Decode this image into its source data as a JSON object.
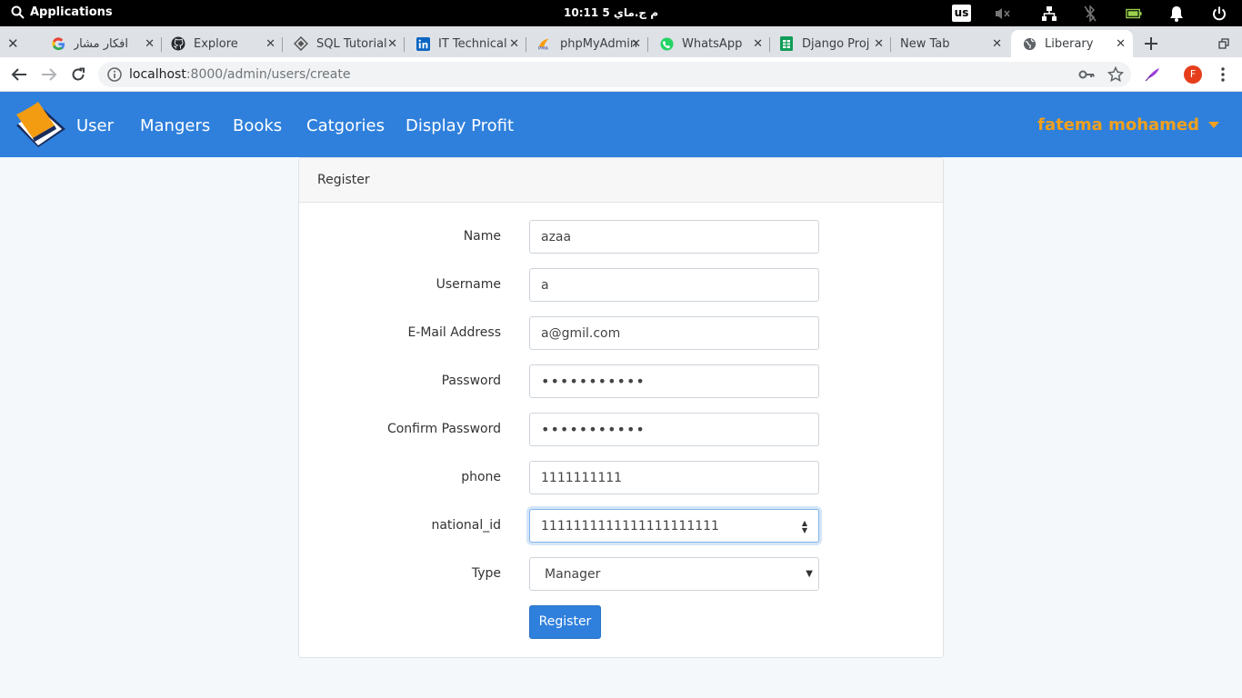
{
  "os": {
    "applications_label": "Applications",
    "clock": "10:11 م   ج.ماي  5",
    "keyboard_layout": "us"
  },
  "tabs": [
    {
      "title": "",
      "icon": "window-close-icon"
    },
    {
      "title": "افكار مشاريع",
      "icon": "google-icon"
    },
    {
      "title": "Explore",
      "icon": "github-icon"
    },
    {
      "title": "SQL Tutorial",
      "icon": "sql-tutorial-icon"
    },
    {
      "title": "IT Technical",
      "icon": "linkedin-icon"
    },
    {
      "title": "phpMyAdmin",
      "icon": "phpmyadmin-icon"
    },
    {
      "title": "WhatsApp",
      "icon": "whatsapp-icon"
    },
    {
      "title": "Django Proj",
      "icon": "sheets-icon"
    },
    {
      "title": "New Tab",
      "icon": ""
    },
    {
      "title": "Liberary",
      "icon": "globe-icon"
    }
  ],
  "address_bar": {
    "host": "localhost",
    "path": ":8000/admin/users/create"
  },
  "profile_initial": "F",
  "navbar": {
    "links": [
      "User",
      "Mangers",
      "Books",
      "Catgories",
      "Display Profit"
    ],
    "user_name": "fatema mohamed",
    "brand_color": "#2f80dc",
    "user_color": "#f0a01e"
  },
  "form": {
    "header": "Register",
    "fields": [
      {
        "label": "Name",
        "value": "azaa"
      },
      {
        "label": "Username",
        "value": "a"
      },
      {
        "label": "E-Mail Address",
        "value": "a@gmil.com"
      },
      {
        "label": "Password",
        "value": "•••••••••••"
      },
      {
        "label": "Confirm Password",
        "value": "•••••••••••"
      },
      {
        "label": "phone",
        "value": "1111111111"
      },
      {
        "label": "national_id",
        "value": "1111111111111111111111"
      },
      {
        "label": "Type",
        "value": "Manager"
      }
    ],
    "submit_label": "Register"
  }
}
